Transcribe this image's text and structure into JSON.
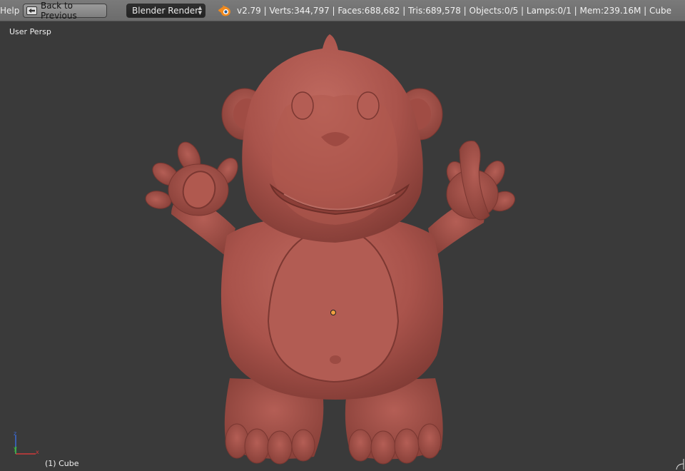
{
  "header": {
    "help_menu": "Help",
    "back_button": "Back to Previous",
    "render_engine": "Blender Render",
    "stats": "v2.79 | Verts:344,797 | Faces:688,682 | Tris:689,578 | Objects:0/5 | Lamps:0/1 | Mem:239.16M | Cube"
  },
  "viewport": {
    "view_label": "User Persp",
    "object_label": "(1) Cube",
    "gizmo": {
      "x": "x",
      "y": "y",
      "z": "z"
    }
  },
  "colors": {
    "header_bg": "#717171",
    "viewport_bg": "#3a3a3a",
    "model": "#a9534b",
    "origin_dot": "#f0a040"
  },
  "icons": [
    "back-arrow-icon",
    "dropdown-arrows-icon",
    "blender-logo-icon",
    "axis-gizmo-icon"
  ]
}
